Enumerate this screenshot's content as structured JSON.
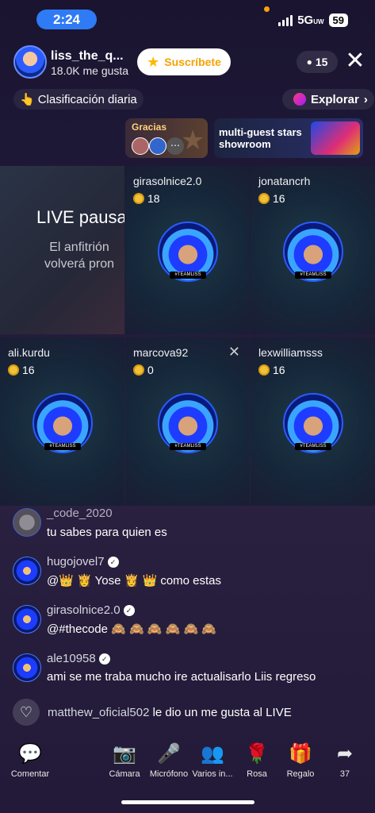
{
  "status": {
    "time": "2:24",
    "network": "5G",
    "network_sub": "UW",
    "battery": "59"
  },
  "host": {
    "name": "liss_the_q...",
    "likes": "18.0K me gusta",
    "subscribe_label": "Suscríbete",
    "viewers": "15"
  },
  "ranking_label": "Clasificación diaria",
  "explore_label": "Explorar",
  "gracias": {
    "title": "Gracias"
  },
  "multi_guest": {
    "text": "multi-guest stars showroom"
  },
  "grid": {
    "paused": {
      "title": "LIVE pausa",
      "line1": "El anfitrión",
      "line2": "volverá pron"
    },
    "guests": [
      {
        "name": "girasolnice2.0",
        "coins": "18"
      },
      {
        "name": "jonatancrh",
        "coins": "16"
      },
      {
        "name": "ali.kurdu",
        "coins": "16"
      },
      {
        "name": "marcova92",
        "coins": "0"
      },
      {
        "name": "lexwilliamsss",
        "coins": "16"
      }
    ]
  },
  "chat": [
    {
      "user": "_code_2020",
      "text": "tu sabes para quien es"
    },
    {
      "user": "hugojovel7",
      "text": "@👑 👸 Yose 👸 👑  como estas"
    },
    {
      "user": "girasolnice2.0",
      "text": "@#thecode 🙈 🙈 🙈 🙈 🙈 🙈"
    },
    {
      "user": "ale10958",
      "text": "ami se me traba mucho ire actualisarlo Liis regreso"
    }
  ],
  "like_event": {
    "user": "matthew_oficial502",
    "text": "le dio un me gusta al LIVE"
  },
  "bottom_bar": {
    "comment": "Comentar",
    "camera": "Cámara",
    "mic": "Micrófono",
    "multi": "Varios in...",
    "rose": "Rosa",
    "gift": "Regalo",
    "share_count": "37"
  }
}
